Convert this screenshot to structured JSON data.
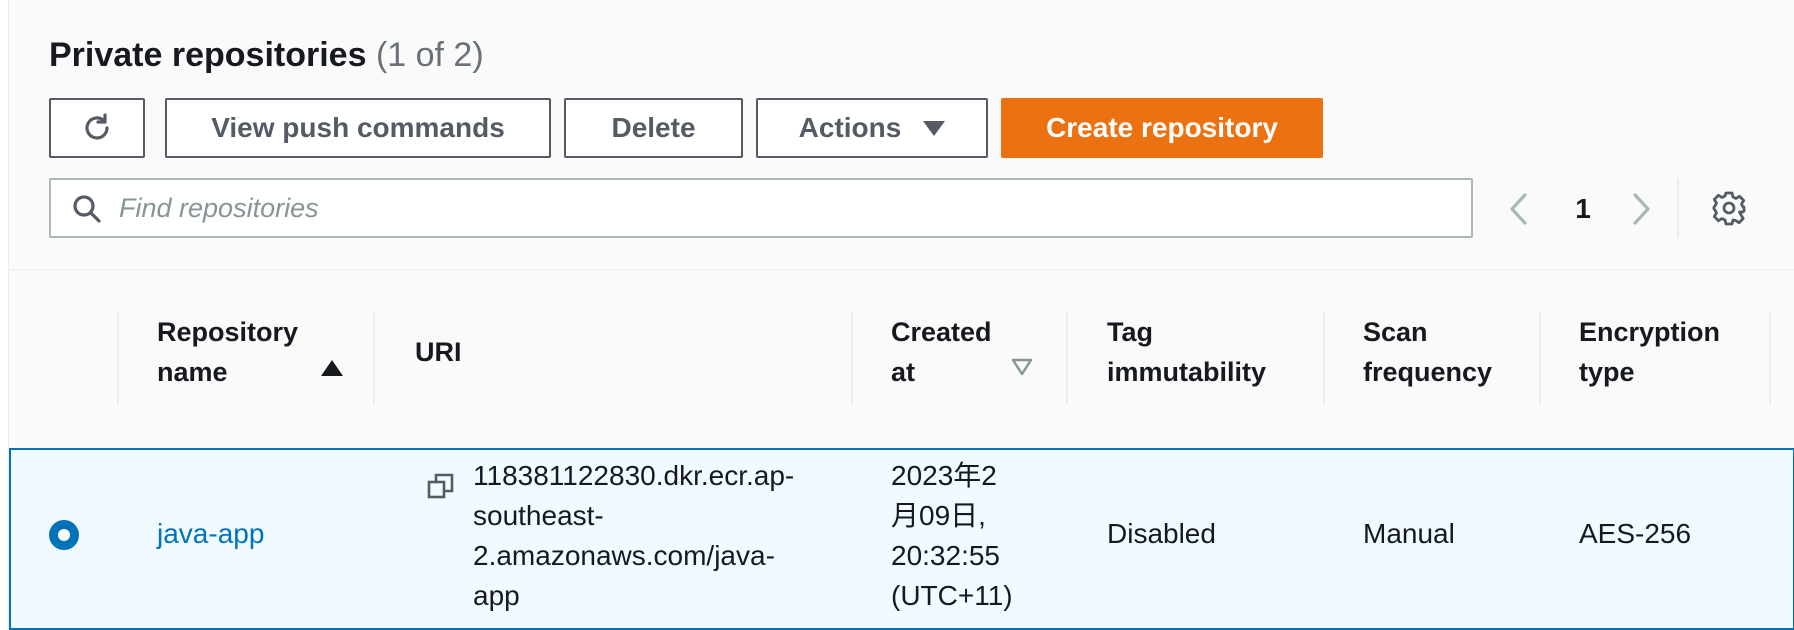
{
  "header": {
    "title": "Private repositories",
    "count": "(1 of 2)"
  },
  "toolbar": {
    "refresh_icon": "refresh-icon",
    "push_label": "View push commands",
    "delete_label": "Delete",
    "actions_label": "Actions",
    "create_label": "Create repository"
  },
  "search": {
    "placeholder": "Find repositories",
    "value": ""
  },
  "pagination": {
    "current_page": "1"
  },
  "table": {
    "columns": [
      {
        "line1": "Repository",
        "line2": "name",
        "sort": "ascending"
      },
      {
        "line1": "URI",
        "line2": ""
      },
      {
        "line1": "Created",
        "line2": "at",
        "sort": "sortable"
      },
      {
        "line1": "Tag",
        "line2": "immutability"
      },
      {
        "line1": "Scan",
        "line2": "frequency"
      },
      {
        "line1": "Encryption",
        "line2": "type"
      }
    ],
    "rows": [
      {
        "selected": true,
        "name": "java-app",
        "uri_lines": [
          "118381122830.dkr.ecr.ap-",
          "southeast-",
          "2.amazonaws.com/java-",
          "app"
        ],
        "created_lines": [
          "2023年2",
          "月09日,",
          "20:32:55",
          "(UTC+11)"
        ],
        "tag_immutability": "Disabled",
        "scan_frequency": "Manual",
        "encryption_type": "AES-256"
      }
    ]
  },
  "colors": {
    "primary": "#ec7211",
    "link": "#0073bb",
    "selected_row_bg": "#f1faff"
  }
}
